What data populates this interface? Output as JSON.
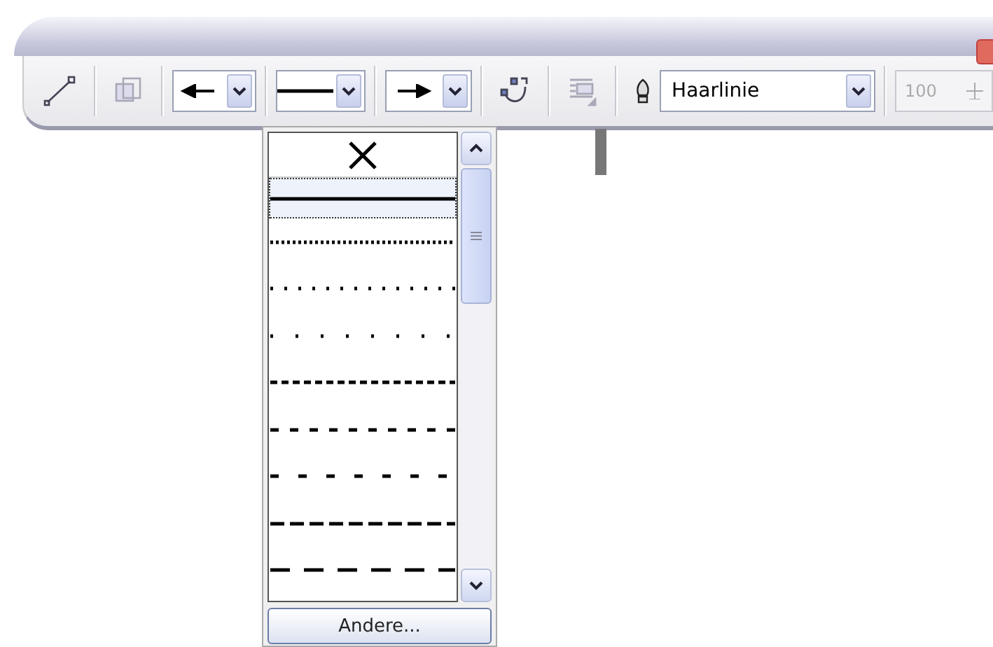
{
  "toolbar": {
    "tools_left": [
      {
        "kind": "node-line",
        "disabled": false
      },
      {
        "kind": "frame",
        "disabled": true
      }
    ],
    "start_arrow": {
      "kind": "arrow-left"
    },
    "line_style": {
      "kind": "solid"
    },
    "end_arrow": {
      "kind": "arrow-right"
    },
    "tools_right": [
      {
        "kind": "curve",
        "disabled": false
      },
      {
        "kind": "text-wrap",
        "disabled": true
      }
    ],
    "outline_width": {
      "value": "Haarlinie"
    },
    "scale": {
      "value": "100",
      "disabled": true
    }
  },
  "line_menu": {
    "none_selected": false,
    "items": [
      {
        "kind": "solid",
        "selected": true
      },
      {
        "kind": "dotted-fine",
        "selected": false
      },
      {
        "kind": "dotted",
        "selected": false
      },
      {
        "kind": "dotted-wide",
        "selected": false
      },
      {
        "kind": "dashed-fine",
        "selected": false
      },
      {
        "kind": "dashed",
        "selected": false
      },
      {
        "kind": "dashed-wide",
        "selected": false
      },
      {
        "kind": "long-dash",
        "selected": false
      },
      {
        "kind": "long-dash-wide",
        "selected": false
      }
    ],
    "more_button": "Andere..."
  }
}
